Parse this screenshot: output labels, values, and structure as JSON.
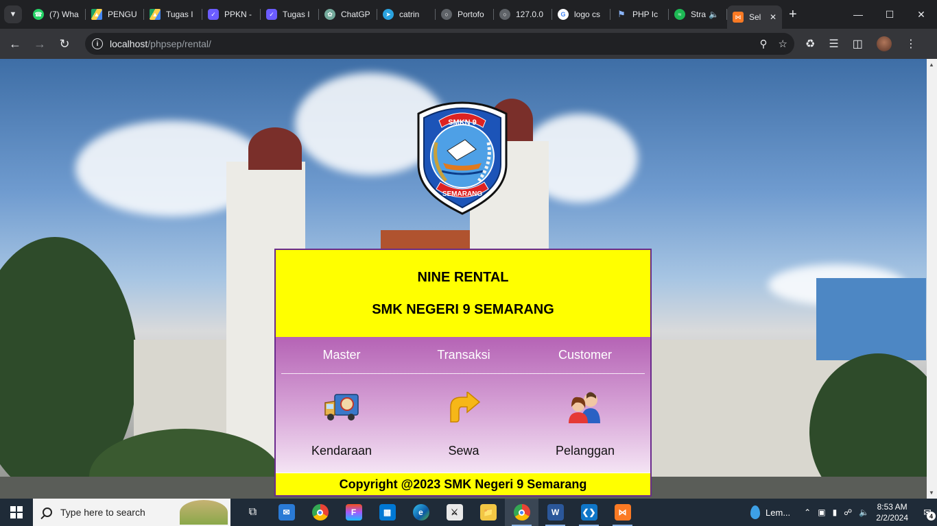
{
  "browser": {
    "tabs": [
      {
        "label": "(7) Wha",
        "icon": "whatsapp-icon",
        "color": "#25d366"
      },
      {
        "label": "PENGU",
        "icon": "google-drive-icon",
        "color": "#1fa463"
      },
      {
        "label": "Tugas I",
        "icon": "google-drive-icon",
        "color": "#1fa463"
      },
      {
        "label": "PPKN -",
        "icon": "padlet-icon",
        "color": "#6b5cff"
      },
      {
        "label": "Tugas I",
        "icon": "padlet-icon",
        "color": "#6b5cff"
      },
      {
        "label": "ChatGP",
        "icon": "chatgpt-icon",
        "color": "#74aa9c"
      },
      {
        "label": "catrin",
        "icon": "telegram-icon",
        "color": "#2aa3e0"
      },
      {
        "label": "Portofo",
        "icon": "globe-icon",
        "color": "#5f6368"
      },
      {
        "label": "127.0.0",
        "icon": "globe-icon",
        "color": "#5f6368"
      },
      {
        "label": "logo cs",
        "icon": "google-icon",
        "color": "#ffffff"
      },
      {
        "label": "PHP Ic",
        "icon": "flag-icon",
        "color": "#8ab4f8"
      },
      {
        "label": "Stra",
        "icon": "spotify-icon",
        "color": "#1db954"
      }
    ],
    "active_tab": {
      "label": "Sel",
      "icon": "xampp-icon",
      "color": "#fb7a24"
    },
    "url_host": "localhost",
    "url_path": "/phpsep/rental/"
  },
  "page": {
    "title": "NINE RENTAL",
    "subtitle": "SMK NEGERI 9 SEMARANG",
    "logo": {
      "top_text": "SMKN 9",
      "bottom_text": "SEMARANG"
    },
    "menu": [
      "Master",
      "Transaksi",
      "Customer"
    ],
    "items": [
      {
        "label": "Kendaraan",
        "icon": "truck-icon"
      },
      {
        "label": "Sewa",
        "icon": "arrow-icon"
      },
      {
        "label": "Pelanggan",
        "icon": "users-icon"
      }
    ],
    "footer": "Copyright @2023 SMK Negeri 9 Semarang"
  },
  "taskbar": {
    "search_placeholder": "Type here to search",
    "weather": "Lem...",
    "time": "8:53 AM",
    "date": "2/2/2024",
    "notifications": "4"
  },
  "colors": {
    "header_yellow": "#ffff00",
    "menu_purple": "#b563b5",
    "panel_border": "#6a2a8c"
  }
}
